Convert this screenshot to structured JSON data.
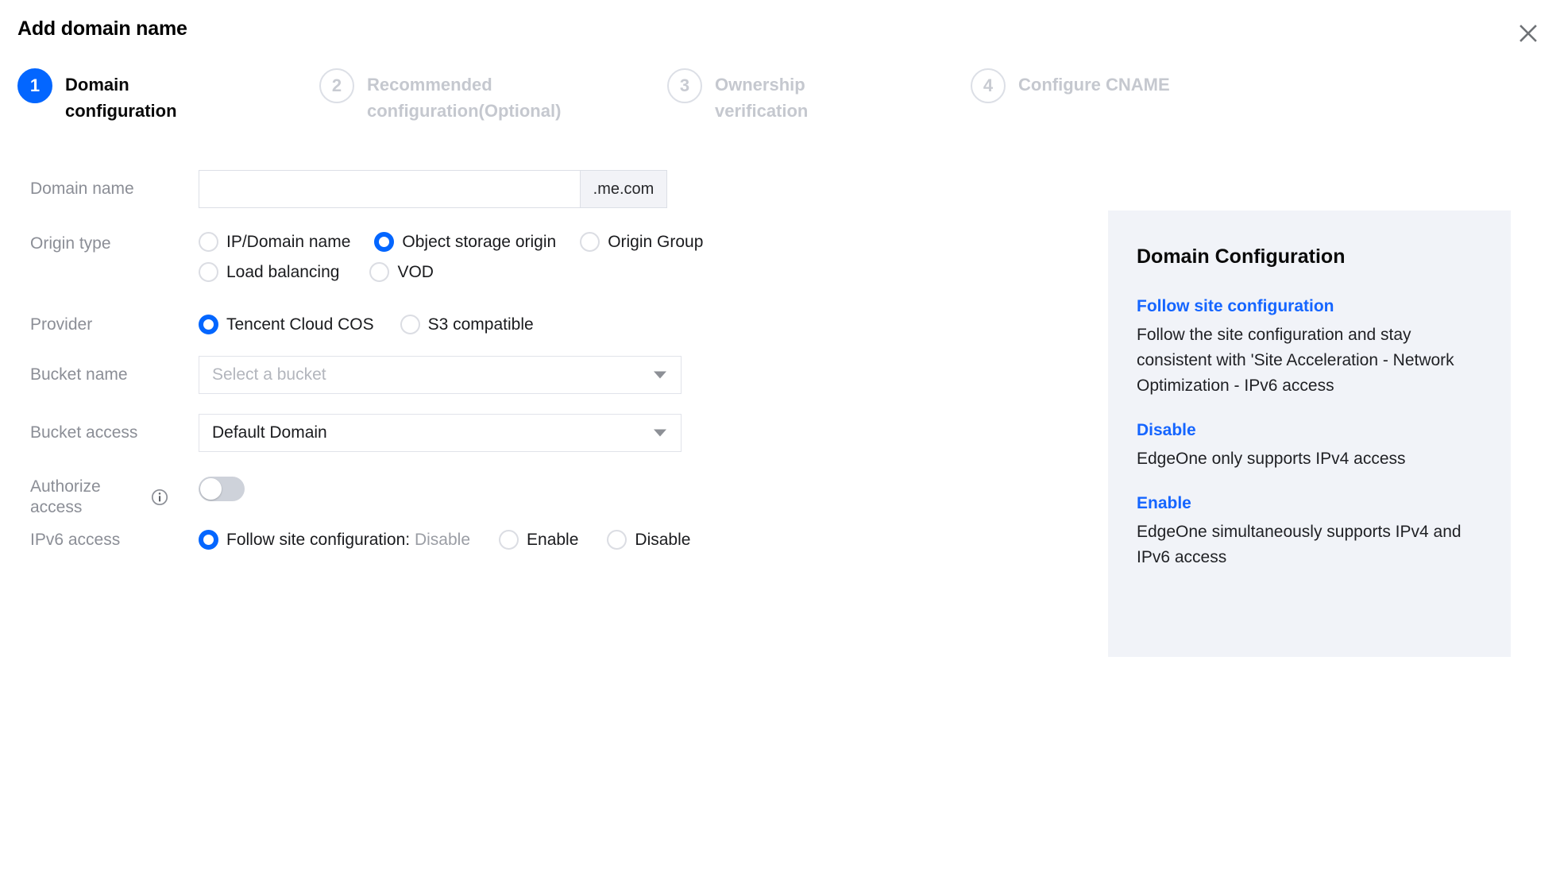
{
  "dialog": {
    "title": "Add domain name",
    "close_icon": "close-icon"
  },
  "stepper": {
    "arrow_icon": "chevron-right-icon",
    "steps": [
      {
        "number": "1",
        "label": "Domain configuration",
        "state": "active"
      },
      {
        "number": "2",
        "label": "Recommended configuration(Optional)",
        "state": "inactive"
      },
      {
        "number": "3",
        "label": "Ownership verification",
        "state": "inactive"
      },
      {
        "number": "4",
        "label": "Configure CNAME",
        "state": "inactive"
      }
    ]
  },
  "form": {
    "domain_name": {
      "label": "Domain name",
      "value": "",
      "placeholder": "",
      "suffix": ".me.com"
    },
    "origin_type": {
      "label": "Origin type",
      "options": [
        {
          "label": "IP/Domain name",
          "checked": false
        },
        {
          "label": "Object storage origin",
          "checked": true
        },
        {
          "label": "Origin Group",
          "checked": false
        },
        {
          "label": "Load balancing",
          "checked": false
        },
        {
          "label": "VOD",
          "checked": false
        }
      ]
    },
    "provider": {
      "label": "Provider",
      "options": [
        {
          "label": "Tencent Cloud COS",
          "checked": true
        },
        {
          "label": "S3 compatible",
          "checked": false
        }
      ]
    },
    "bucket_name": {
      "label": "Bucket name",
      "value": "",
      "placeholder": "Select a bucket"
    },
    "bucket_access": {
      "label": "Bucket access",
      "value": "Default Domain"
    },
    "authorize_access": {
      "label": "Authorize access",
      "info_icon": "info-icon",
      "enabled": false
    },
    "ipv6_access": {
      "label": "IPv6 access",
      "options": [
        {
          "label": "Follow site configuration:",
          "suffix": "Disable",
          "checked": true
        },
        {
          "label": "Enable",
          "checked": false
        },
        {
          "label": "Disable",
          "checked": false
        }
      ]
    }
  },
  "side_panel": {
    "title": "Domain Configuration",
    "blocks": [
      {
        "heading": "Follow site configuration",
        "body": "Follow the site configuration and stay consistent with 'Site Acceleration - Network Optimization - IPv6 access"
      },
      {
        "heading": "Disable",
        "body": "EdgeOne only supports IPv4 access"
      },
      {
        "heading": "Enable",
        "body": "EdgeOne simultaneously supports IPv4 and IPv6 access"
      }
    ]
  },
  "colors": {
    "accent": "#0366ff",
    "link": "#1565ff",
    "panel_bg": "#f1f3f8",
    "label": "#8b8e96",
    "border": "#dcdfe6"
  }
}
